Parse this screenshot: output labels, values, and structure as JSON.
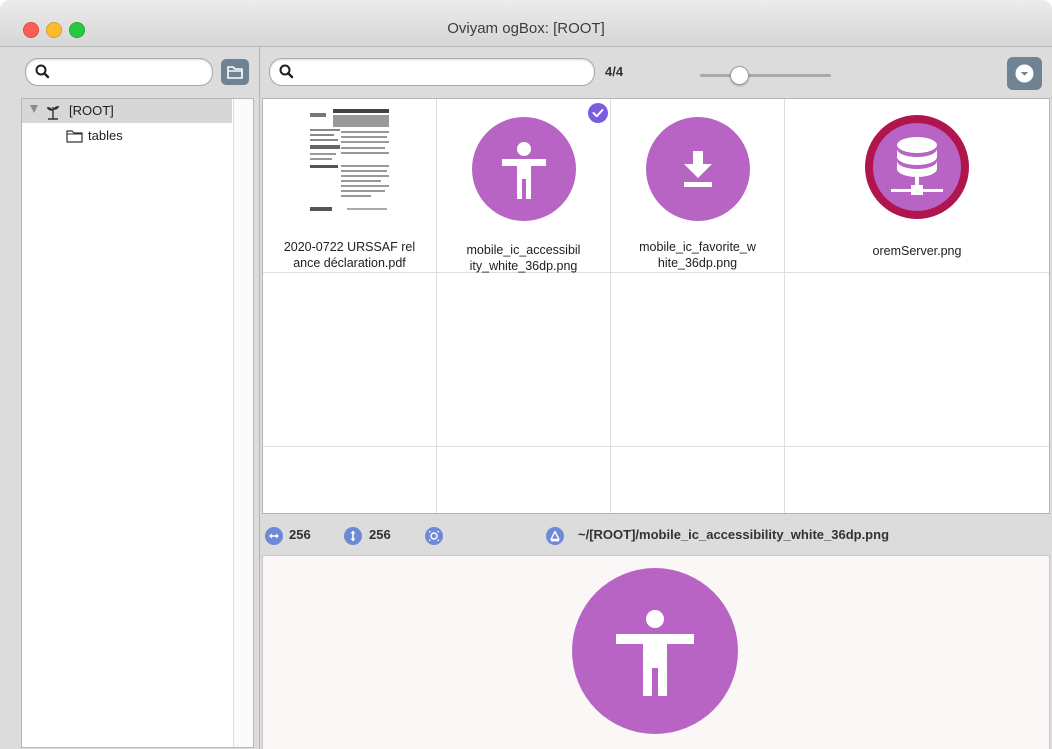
{
  "window": {
    "title": "Oviyam ogBox: [ROOT]"
  },
  "left": {
    "search": {
      "value": "",
      "placeholder": ""
    },
    "folder_button_icon": "folder-icon",
    "tree": [
      {
        "label": "[ROOT]",
        "icon": "plant-icon",
        "expanded": true,
        "selected": true
      },
      {
        "label": "tables",
        "icon": "folder-icon"
      }
    ]
  },
  "toolbar": {
    "search": {
      "value": "",
      "placeholder": ""
    },
    "count": "4/4",
    "zoom_level": 0.3,
    "menu_icon": "chevron-down-circle-icon"
  },
  "files": [
    {
      "name_line1": "2020-0722 URSSAF rel",
      "name_line2": "ance déclaration.pdf",
      "thumb": "document-thumbnail",
      "selected": false
    },
    {
      "name_line1": "mobile_ic_accessibil",
      "name_line2": "ity_white_36dp.png",
      "thumb": "accessibility-icon",
      "selected": true
    },
    {
      "name_line1": "mobile_ic_favorite_w",
      "name_line2": "hite_36dp.png",
      "thumb": "download-icon",
      "selected": false
    },
    {
      "name_line1": "oremServer.png",
      "name_line2": "",
      "thumb": "database-server-icon",
      "selected": false
    }
  ],
  "status": {
    "width": "256",
    "height": "256",
    "path": "~/[ROOT]/mobile_ic_accessibility_white_36dp.png"
  },
  "colors": {
    "accent_purple": "#b764c5",
    "server_ring": "#b0154e",
    "check_blue": "#7b5be0",
    "status_icon_blue": "#6d8ad8",
    "button_slate": "#6f8395"
  }
}
